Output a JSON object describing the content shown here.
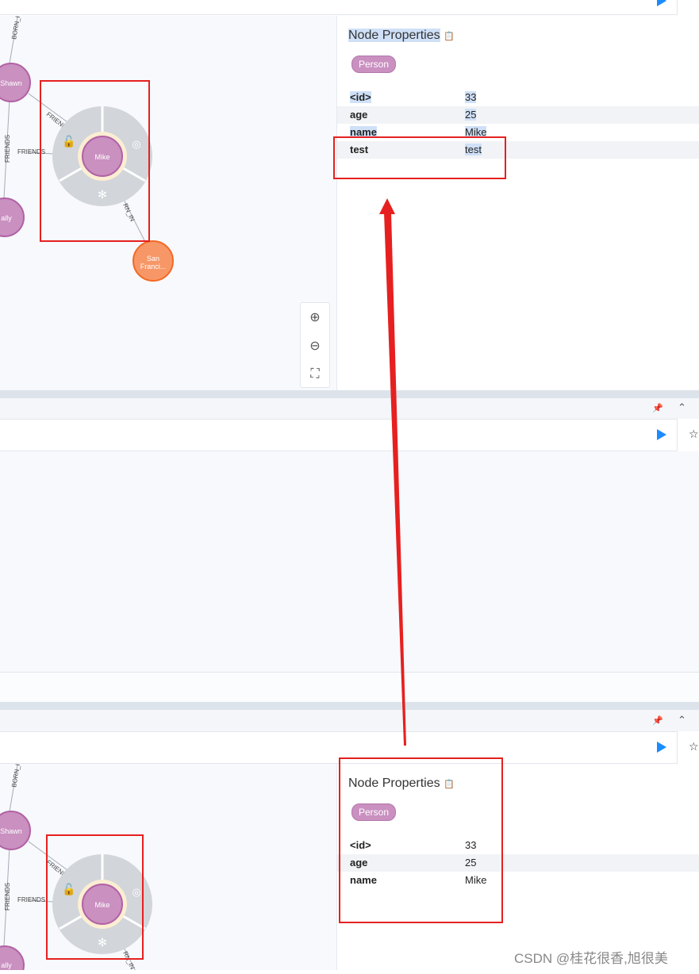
{
  "top_frame": {
    "node_properties": {
      "title": "Node Properties",
      "label": "Person",
      "rows": [
        {
          "key": "<id>",
          "value": "33"
        },
        {
          "key": "age",
          "value": "25"
        },
        {
          "key": "name",
          "value": "Mike"
        },
        {
          "key": "test",
          "value": "test"
        }
      ]
    },
    "graph": {
      "nodes": {
        "shawn": "Shawn",
        "sally": "ally",
        "mike": "Mike",
        "sf_line1": "San",
        "sf_line2": "Franci..."
      },
      "edges": {
        "born_in_top": "BORN_I",
        "friends_diag": "FRIENI",
        "friends_v": "FRIENDS",
        "friends_h": "FRIENDS",
        "born_in_right": "RN_IN"
      }
    }
  },
  "middle_frame": {},
  "bottom_frame": {
    "node_properties": {
      "title": "Node Properties",
      "label": "Person",
      "rows": [
        {
          "key": "<id>",
          "value": "33"
        },
        {
          "key": "age",
          "value": "25"
        },
        {
          "key": "name",
          "value": "Mike"
        }
      ]
    },
    "graph": {
      "nodes": {
        "shawn": "Shawn",
        "sally": "ally",
        "mike": "Mike"
      },
      "edges": {
        "born_in_top": "BORN_I",
        "friends_diag": "FRIENI",
        "friends_v": "FRIENDS",
        "friends_h": "FRIENDS",
        "born_in_right": "RN_IN"
      }
    }
  },
  "watermark": "CSDN @桂花很香,旭很美",
  "colors": {
    "annotation_red": "#e62020",
    "node_person": "#c990c0",
    "node_city": "#f79767",
    "play_blue": "#1a8cff"
  }
}
